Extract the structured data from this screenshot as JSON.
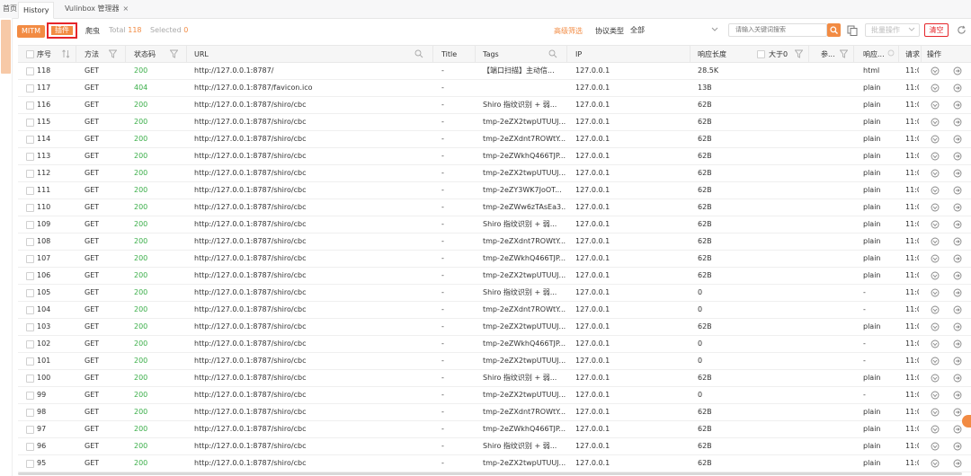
{
  "tabs": {
    "home": "首页",
    "history": "History",
    "vulinbox": "Vulinbox 管理器",
    "close": "×"
  },
  "toolbar": {
    "mitm": "MITM",
    "plugin": "插件",
    "crawler": "爬虫",
    "total_label": "Total",
    "total_value": "118",
    "selected_label": "Selected",
    "selected_value": "0",
    "advanced_filter": "高级筛选",
    "protocol_label": "协议类型",
    "protocol_value": "全部",
    "search_placeholder": "请输入关键词搜索",
    "batch_label": "批量操作",
    "clear_label": "清空"
  },
  "columns": [
    "序号",
    "方法",
    "状态码",
    "URL",
    "Title",
    "Tags",
    "IP",
    "响应长度",
    "大于0",
    "参...",
    "响应...",
    "请求",
    "操作"
  ],
  "rows": [
    {
      "id": "118",
      "method": "GET",
      "status": "200",
      "url": "http://127.0.0.1:8787/",
      "title": "-",
      "tags": "【端口扫描】主动信...",
      "ip": "127.0.0.1",
      "len": "28.5K",
      "param": "",
      "ctype": "html",
      "time": "11:0"
    },
    {
      "id": "117",
      "method": "GET",
      "status": "404",
      "url": "http://127.0.0.1:8787/favicon.ico",
      "title": "-",
      "tags": "",
      "ip": "127.0.0.1",
      "len": "13B",
      "param": "",
      "ctype": "plain",
      "time": "11:0"
    },
    {
      "id": "116",
      "method": "GET",
      "status": "200",
      "url": "http://127.0.0.1:8787/shiro/cbc",
      "title": "-",
      "tags": "Shiro 指纹识别 + 弱...",
      "ip": "127.0.0.1",
      "len": "62B",
      "param": "",
      "ctype": "plain",
      "time": "11:0"
    },
    {
      "id": "115",
      "method": "GET",
      "status": "200",
      "url": "http://127.0.0.1:8787/shiro/cbc",
      "title": "-",
      "tags": "tmp-2eZX2twpUTUUJ...",
      "ip": "127.0.0.1",
      "len": "62B",
      "param": "",
      "ctype": "plain",
      "time": "11:0"
    },
    {
      "id": "114",
      "method": "GET",
      "status": "200",
      "url": "http://127.0.0.1:8787/shiro/cbc",
      "title": "-",
      "tags": "tmp-2eZXdnt7ROWtY...",
      "ip": "127.0.0.1",
      "len": "62B",
      "param": "",
      "ctype": "plain",
      "time": "11:0"
    },
    {
      "id": "113",
      "method": "GET",
      "status": "200",
      "url": "http://127.0.0.1:8787/shiro/cbc",
      "title": "-",
      "tags": "tmp-2eZWkhQ466TJP...",
      "ip": "127.0.0.1",
      "len": "62B",
      "param": "",
      "ctype": "plain",
      "time": "11:0"
    },
    {
      "id": "112",
      "method": "GET",
      "status": "200",
      "url": "http://127.0.0.1:8787/shiro/cbc",
      "title": "-",
      "tags": "tmp-2eZX2twpUTUUJ...",
      "ip": "127.0.0.1",
      "len": "62B",
      "param": "",
      "ctype": "plain",
      "time": "11:0"
    },
    {
      "id": "111",
      "method": "GET",
      "status": "200",
      "url": "http://127.0.0.1:8787/shiro/cbc",
      "title": "-",
      "tags": "tmp-2eZY3WK7JoOT...",
      "ip": "127.0.0.1",
      "len": "62B",
      "param": "",
      "ctype": "plain",
      "time": "11:0"
    },
    {
      "id": "110",
      "method": "GET",
      "status": "200",
      "url": "http://127.0.0.1:8787/shiro/cbc",
      "title": "-",
      "tags": "tmp-2eZWw6zTAsEa3...",
      "ip": "127.0.0.1",
      "len": "62B",
      "param": "",
      "ctype": "plain",
      "time": "11:0"
    },
    {
      "id": "109",
      "method": "GET",
      "status": "200",
      "url": "http://127.0.0.1:8787/shiro/cbc",
      "title": "-",
      "tags": "Shiro 指纹识别 + 弱...",
      "ip": "127.0.0.1",
      "len": "62B",
      "param": "",
      "ctype": "plain",
      "time": "11:0"
    },
    {
      "id": "108",
      "method": "GET",
      "status": "200",
      "url": "http://127.0.0.1:8787/shiro/cbc",
      "title": "-",
      "tags": "tmp-2eZXdnt7ROWtY...",
      "ip": "127.0.0.1",
      "len": "62B",
      "param": "",
      "ctype": "plain",
      "time": "11:0"
    },
    {
      "id": "107",
      "method": "GET",
      "status": "200",
      "url": "http://127.0.0.1:8787/shiro/cbc",
      "title": "-",
      "tags": "tmp-2eZWkhQ466TJP...",
      "ip": "127.0.0.1",
      "len": "62B",
      "param": "",
      "ctype": "plain",
      "time": "11:0"
    },
    {
      "id": "106",
      "method": "GET",
      "status": "200",
      "url": "http://127.0.0.1:8787/shiro/cbc",
      "title": "-",
      "tags": "tmp-2eZX2twpUTUUJ...",
      "ip": "127.0.0.1",
      "len": "62B",
      "param": "",
      "ctype": "plain",
      "time": "11:0"
    },
    {
      "id": "105",
      "method": "GET",
      "status": "200",
      "url": "http://127.0.0.1:8787/shiro/cbc",
      "title": "-",
      "tags": "Shiro 指纹识别 + 弱...",
      "ip": "127.0.0.1",
      "len": "0",
      "param": "",
      "ctype": "-",
      "time": "11:0"
    },
    {
      "id": "104",
      "method": "GET",
      "status": "200",
      "url": "http://127.0.0.1:8787/shiro/cbc",
      "title": "-",
      "tags": "tmp-2eZXdnt7ROWtY...",
      "ip": "127.0.0.1",
      "len": "0",
      "param": "",
      "ctype": "-",
      "time": "11:0"
    },
    {
      "id": "103",
      "method": "GET",
      "status": "200",
      "url": "http://127.0.0.1:8787/shiro/cbc",
      "title": "-",
      "tags": "tmp-2eZX2twpUTUUJ...",
      "ip": "127.0.0.1",
      "len": "62B",
      "param": "",
      "ctype": "plain",
      "time": "11:0"
    },
    {
      "id": "102",
      "method": "GET",
      "status": "200",
      "url": "http://127.0.0.1:8787/shiro/cbc",
      "title": "-",
      "tags": "tmp-2eZWkhQ466TJP...",
      "ip": "127.0.0.1",
      "len": "0",
      "param": "",
      "ctype": "-",
      "time": "11:0"
    },
    {
      "id": "101",
      "method": "GET",
      "status": "200",
      "url": "http://127.0.0.1:8787/shiro/cbc",
      "title": "-",
      "tags": "tmp-2eZX2twpUTUUJ...",
      "ip": "127.0.0.1",
      "len": "0",
      "param": "",
      "ctype": "-",
      "time": "11:0"
    },
    {
      "id": "100",
      "method": "GET",
      "status": "200",
      "url": "http://127.0.0.1:8787/shiro/cbc",
      "title": "-",
      "tags": "Shiro 指纹识别 + 弱...",
      "ip": "127.0.0.1",
      "len": "62B",
      "param": "",
      "ctype": "plain",
      "time": "11:0"
    },
    {
      "id": "99",
      "method": "GET",
      "status": "200",
      "url": "http://127.0.0.1:8787/shiro/cbc",
      "title": "-",
      "tags": "tmp-2eZX2twpUTUUJ...",
      "ip": "127.0.0.1",
      "len": "0",
      "param": "",
      "ctype": "-",
      "time": "11:0"
    },
    {
      "id": "98",
      "method": "GET",
      "status": "200",
      "url": "http://127.0.0.1:8787/shiro/cbc",
      "title": "-",
      "tags": "tmp-2eZXdnt7ROWtY...",
      "ip": "127.0.0.1",
      "len": "62B",
      "param": "",
      "ctype": "plain",
      "time": "11:0"
    },
    {
      "id": "97",
      "method": "GET",
      "status": "200",
      "url": "http://127.0.0.1:8787/shiro/cbc",
      "title": "-",
      "tags": "tmp-2eZWkhQ466TJP...",
      "ip": "127.0.0.1",
      "len": "62B",
      "param": "",
      "ctype": "plain",
      "time": "11:0"
    },
    {
      "id": "96",
      "method": "GET",
      "status": "200",
      "url": "http://127.0.0.1:8787/shiro/cbc",
      "title": "-",
      "tags": "Shiro 指纹识别 + 弱...",
      "ip": "127.0.0.1",
      "len": "62B",
      "param": "",
      "ctype": "plain",
      "time": "11:0"
    },
    {
      "id": "95",
      "method": "GET",
      "status": "200",
      "url": "http://127.0.0.1:8787/shiro/cbc",
      "title": "-",
      "tags": "tmp-2eZX2twpUTUUJ...",
      "ip": "127.0.0.1",
      "len": "62B",
      "param": "",
      "ctype": "plain",
      "time": "11:0"
    }
  ],
  "colors": {
    "accent": "#f28b43",
    "status_ok": "#3bae49",
    "danger": "#e5252a"
  }
}
